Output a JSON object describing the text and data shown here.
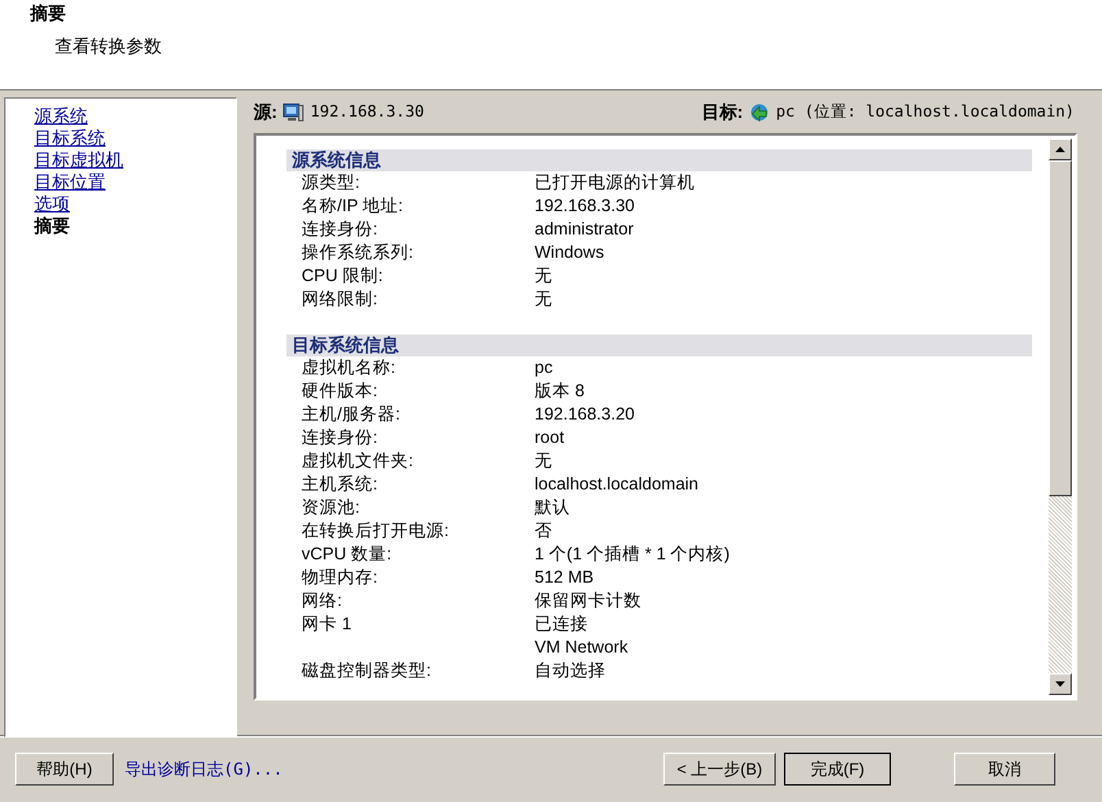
{
  "header": {
    "title": "摘要",
    "subtitle": "查看转换参数"
  },
  "nav": [
    {
      "label": "源系统",
      "selected": false
    },
    {
      "label": "目标系统",
      "selected": false
    },
    {
      "label": "目标虚拟机",
      "selected": false
    },
    {
      "label": "目标位置",
      "selected": false
    },
    {
      "label": "选项",
      "selected": false
    },
    {
      "label": "摘要",
      "selected": true
    }
  ],
  "source": {
    "label": "源:",
    "value": "192.168.3.30"
  },
  "target": {
    "label": "目标:",
    "value": "pc (位置: localhost.localdomain)"
  },
  "sections": [
    {
      "title": "源系统信息",
      "rows": [
        {
          "label": "源类型:",
          "value": "已打开电源的计算机"
        },
        {
          "label": "名称/IP 地址:",
          "value": "192.168.3.30"
        },
        {
          "label": "连接身份:",
          "value": "administrator"
        },
        {
          "label": "操作系统系列:",
          "value": "Windows"
        },
        {
          "label": "CPU 限制:",
          "value": "无"
        },
        {
          "label": "网络限制:",
          "value": "无"
        }
      ]
    },
    {
      "title": "目标系统信息",
      "rows": [
        {
          "label": "虚拟机名称:",
          "value": "pc"
        },
        {
          "label": "硬件版本:",
          "value": "版本 8"
        },
        {
          "label": "主机/服务器:",
          "value": "192.168.3.20"
        },
        {
          "label": "连接身份:",
          "value": "root"
        },
        {
          "label": "虚拟机文件夹:",
          "value": "无"
        },
        {
          "label": "主机系统:",
          "value": "localhost.localdomain"
        },
        {
          "label": "资源池:",
          "value": "默认"
        },
        {
          "label": "在转换后打开电源:",
          "value": "否"
        },
        {
          "label": "vCPU 数量:",
          "value": "1 个(1 个插槽 * 1 个内核)"
        },
        {
          "label": "物理内存:",
          "value": "512 MB"
        },
        {
          "label": "网络:",
          "value": "保留网卡计数"
        },
        {
          "label": "网卡 1",
          "value": "已连接"
        },
        {
          "value": "VM Network"
        },
        {
          "label": "磁盘控制器类型:",
          "value": "自动选择"
        }
      ]
    }
  ],
  "footer": {
    "help": "帮助(H)",
    "log_link": "导出诊断日志(G)...",
    "back": "< 上一步(B)",
    "finish": "完成(F)",
    "cancel": "取消"
  }
}
